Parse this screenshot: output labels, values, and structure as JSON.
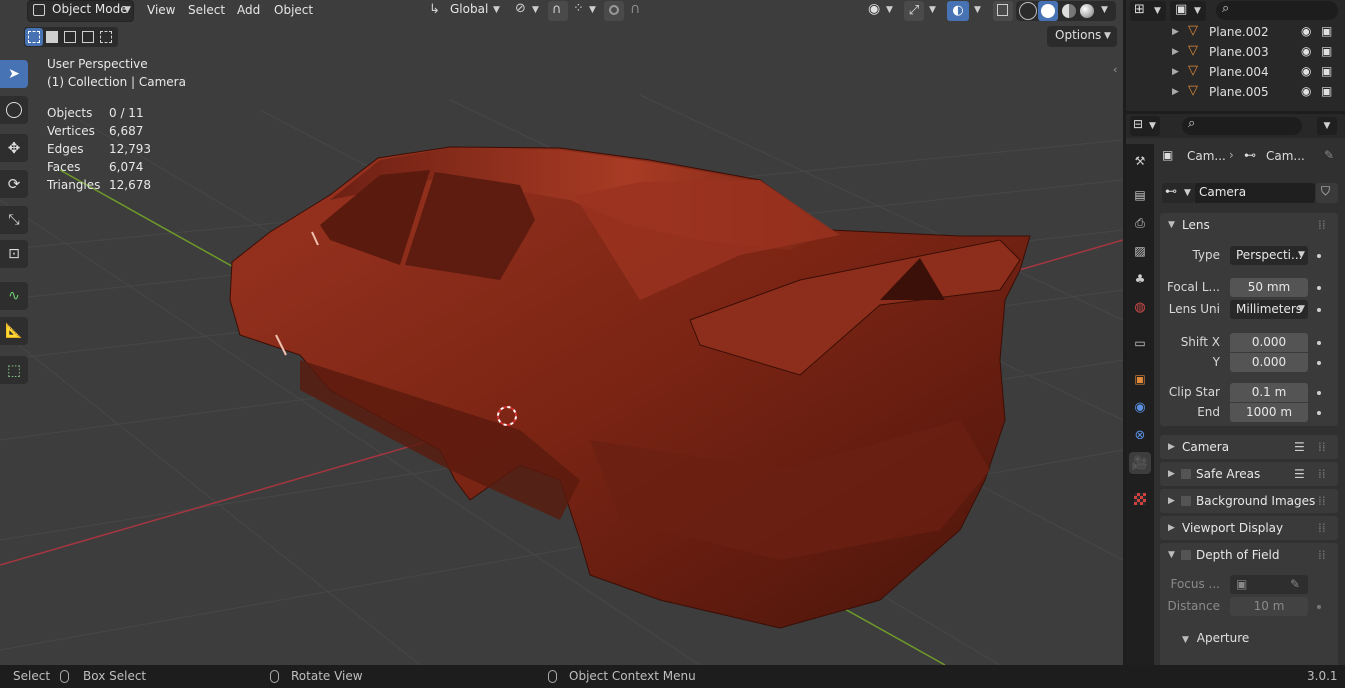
{
  "header": {
    "mode_label": "Object Mode",
    "menus": [
      "View",
      "Select",
      "Add",
      "Object"
    ],
    "transform_orientation": "Global",
    "options_label": "Options"
  },
  "overlay": {
    "perspective": "User Perspective",
    "collection": "(1) Collection | Camera"
  },
  "stats": [
    {
      "label": "Objects",
      "value": "0 / 11"
    },
    {
      "label": "Vertices",
      "value": "6,687"
    },
    {
      "label": "Edges",
      "value": "12,793"
    },
    {
      "label": "Faces",
      "value": "6,074"
    },
    {
      "label": "Triangles",
      "value": "12,678"
    }
  ],
  "outliner": {
    "items": [
      "Plane.002",
      "Plane.003",
      "Plane.004",
      "Plane.005"
    ]
  },
  "properties": {
    "breadcrumb": [
      "Cam...",
      "Cam..."
    ],
    "datablock_name": "Camera",
    "lens": {
      "title": "Lens",
      "type_label": "Type",
      "type_value": "Perspecti...",
      "focal_label": "Focal L...",
      "focal_value": "50 mm",
      "unit_label": "Lens Uni",
      "unit_value": "Millimeters",
      "shift_x_label": "Shift X",
      "shift_x_value": "0.000",
      "shift_y_label": "Y",
      "shift_y_value": "0.000",
      "clip_start_label": "Clip Star",
      "clip_start_value": "0.1 m",
      "clip_end_label": "End",
      "clip_end_value": "1000 m"
    },
    "panels": {
      "camera": "Camera",
      "safe_areas": "Safe Areas",
      "background_images": "Background Images",
      "viewport_display": "Viewport Display",
      "depth_of_field": "Depth of Field"
    },
    "dof": {
      "focus_label": "Focus ...",
      "distance_label": "Distance",
      "distance_value": "10 m",
      "aperture_title": "Aperture"
    }
  },
  "statusbar": {
    "select": "Select",
    "box_select": "Box Select",
    "rotate_view": "Rotate View",
    "context_menu": "Object Context Menu",
    "version": "3.0.1"
  },
  "colors": {
    "accent": "#4772b3",
    "viewport_bg": "#3d3d3d",
    "car_body": "#8a2a18",
    "axis_x": "#a5363f",
    "axis_y": "#6e9a2a",
    "object_orange": "#e08a3c"
  }
}
